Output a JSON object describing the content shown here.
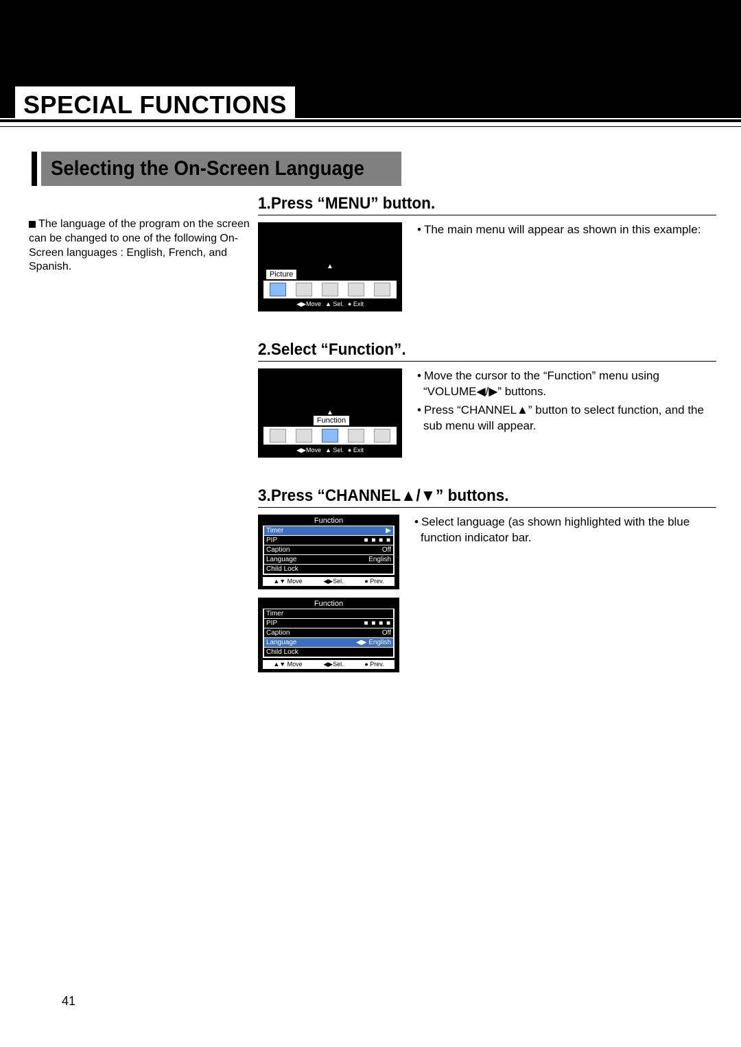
{
  "section_title": "SPECIAL FUNCTIONS",
  "subhead": "Selecting the On-Screen Language",
  "left_note": "The language of the program on the screen can be changed to one of the following On-Screen languages : English, French, and Spanish.",
  "steps": {
    "s1": {
      "title": "1.Press “MENU” button.",
      "desc1": "The main menu will appear as shown in this example:",
      "osd": {
        "label": "Picture",
        "footer_move": "◀▶Move",
        "footer_sel": "▲ Sel.",
        "footer_exit": "● Exit"
      }
    },
    "s2": {
      "title": "2.Select “Function”.",
      "desc1": "Move the cursor to the “Function” menu using “VOLUME◀/▶” buttons.",
      "desc2": "Press “CHANNEL▲” button to select function, and the sub menu will appear.",
      "osd": {
        "label": "Function",
        "footer_move": "◀▶Move",
        "footer_sel": "▲ Sel.",
        "footer_exit": "● Exit"
      }
    },
    "s3": {
      "title": "3.Press “CHANNEL▲/▼” buttons.",
      "desc1": "Select language (as shown highlighted with the blue function indicator bar.",
      "menu_title": "Function",
      "rows": [
        {
          "l": "Timer",
          "r": "▶"
        },
        {
          "l": "PIP",
          "r": "■ ■ ■ ■"
        },
        {
          "l": "Caption",
          "r": "Off"
        },
        {
          "l": "Language",
          "r": "English"
        },
        {
          "l": "Child Lock",
          "r": ""
        }
      ],
      "rows2_sel_r": "◀▶  English",
      "footer_move": "▲▼ Move",
      "footer_sel": "◀▶Sel.",
      "footer_prev": "● Prev."
    }
  },
  "page_number": "41"
}
